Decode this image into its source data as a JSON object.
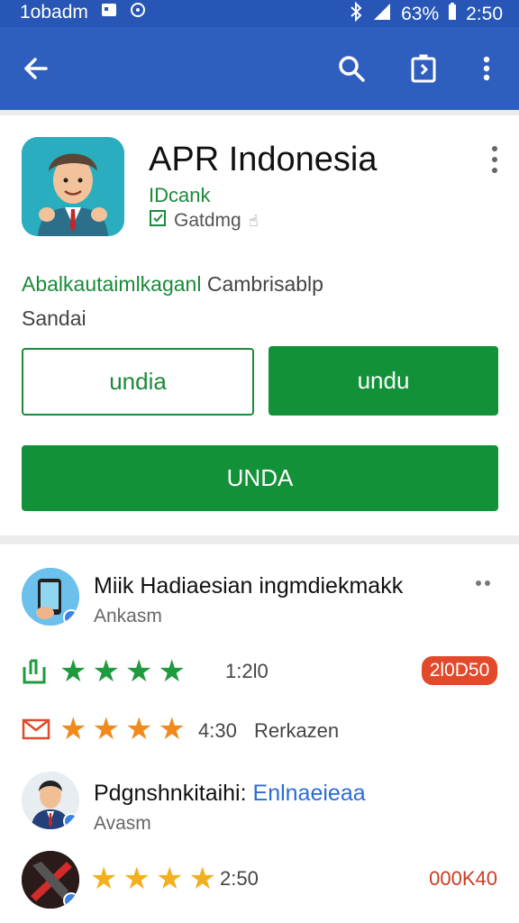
{
  "status": {
    "carrier": "1obadm",
    "battery_pct": "63%",
    "time": "2:50"
  },
  "app": {
    "title": "APR Indonesia",
    "developer": "IDcank",
    "badge": "Gatdmg"
  },
  "description": {
    "green_text": "Abalkautaimlkaganl",
    "rest_text": "Cambrisablp",
    "line2": "Sandai"
  },
  "buttons": {
    "outline_label": "undia",
    "filled_label": "undu",
    "wide_label": "UNDA"
  },
  "related": [
    {
      "title": "Miik Hadiaesian ingmdiekmakk",
      "sub": "Ankasm"
    },
    {
      "title": "Pdgnshnkitaihi:",
      "title_link": "Enlnaeieaa",
      "sub": "Avasm"
    }
  ],
  "ratings": [
    {
      "stars": 4,
      "color": "#1f9a3f",
      "value": "1:2l0",
      "count": "2l0D50"
    },
    {
      "stars": 4,
      "color": "#f08a1c",
      "value": "4:30",
      "suffix": "Rerkazen"
    },
    {
      "stars": 3.5,
      "color": "#f2b01e",
      "value": "2:50",
      "count": "000K40"
    }
  ],
  "icons": [
    "back-arrow-icon",
    "search-icon",
    "share-icon",
    "more-vert-icon",
    "bluetooth-icon",
    "signal-icon",
    "battery-icon",
    "image-icon",
    "alarm-icon"
  ]
}
